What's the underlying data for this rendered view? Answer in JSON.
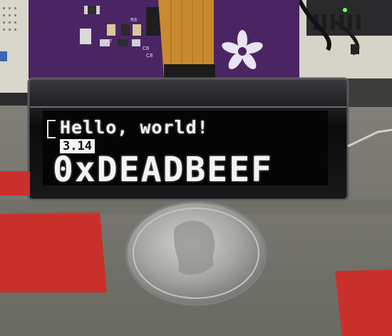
{
  "oled": {
    "line1": "Hello, world!",
    "line2": "3.14",
    "line3": "0xDEADBEEF"
  },
  "pcb_silkscreen": {
    "r7": "R7",
    "r6": "R6",
    "c6": "C6",
    "c8": "C8"
  },
  "colors": {
    "pcb_purple": "#4b2563",
    "flex_cable": "#c9892f",
    "oled_glass": "#0a0a0c",
    "oled_text": "#f4f4f4",
    "table_gray": "#7a7a72",
    "tape_red": "#c9302c",
    "coin_silver": "#a9aaa6"
  },
  "icons": {
    "logo": "adafruit-flower-logo"
  }
}
